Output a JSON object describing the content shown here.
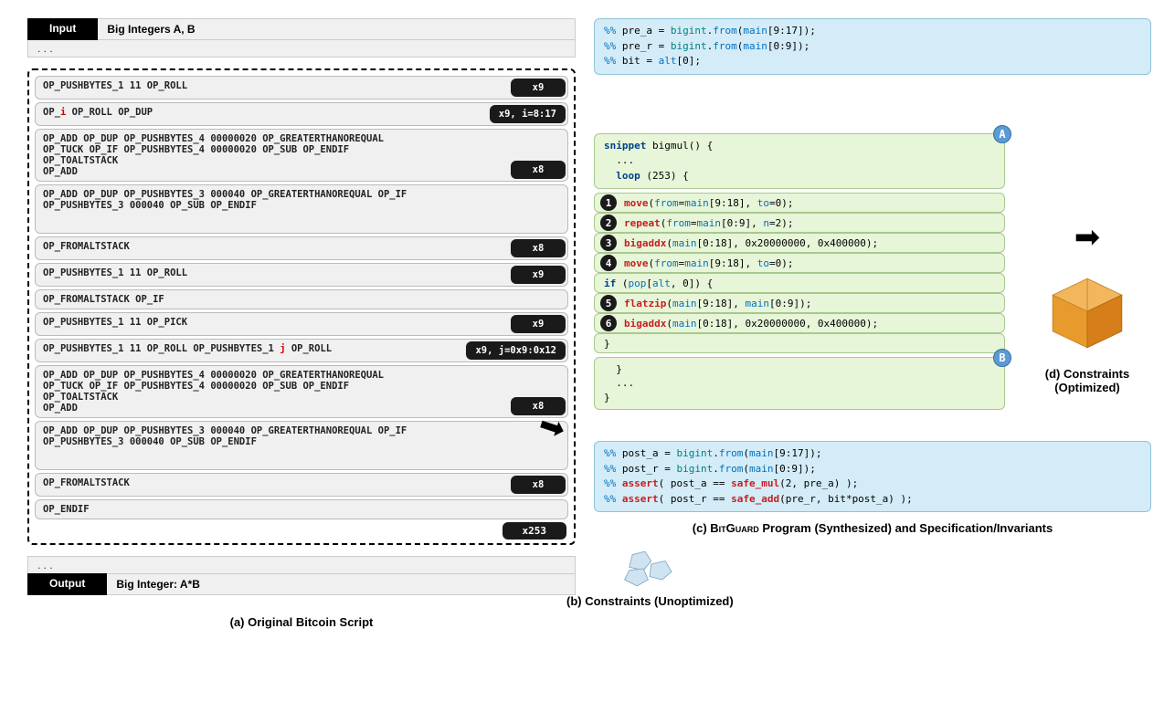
{
  "input": {
    "label": "Input",
    "value": "Big Integers A, B",
    "ellipsis": ". . ."
  },
  "output": {
    "label": "Output",
    "value": "Big Integer: A*B",
    "ellipsis": ". . ."
  },
  "captions": {
    "a": "(a) Original Bitcoin Script",
    "b": "(b) Constraints (Unoptimized)",
    "c_prefix": "(c) ",
    "c_name": "BitGuard",
    "c_suffix": " Program (Synthesized) and Specification/Invariants",
    "d": "(d) Constraints (Optimized)"
  },
  "x253": "x253",
  "ops": [
    {
      "text": "OP_PUSHBYTES_1 11 OP_ROLL",
      "badge": "x9"
    },
    {
      "pre": "OP_",
      "red": "i",
      "post": " OP_ROLL OP_DUP",
      "badge": "x9, i=8:17"
    },
    {
      "text": "OP_ADD OP_DUP OP_PUSHBYTES_4 00000020 OP_GREATERTHANOREQUAL\nOP_TUCK OP_IF OP_PUSHBYTES_4 00000020 OP_SUB OP_ENDIF\nOP_TOALTSTACK\nOP_ADD",
      "badge": "x8",
      "tall": true
    },
    {
      "text": "OP_ADD OP_DUP OP_PUSHBYTES_3 000040 OP_GREATERTHANOREQUAL OP_IF\nOP_PUSHBYTES_3 000040 OP_SUB OP_ENDIF",
      "tall": true
    },
    {
      "text": "OP_FROMALTSTACK",
      "badge": "x8"
    },
    {
      "text": "OP_PUSHBYTES_1 11 OP_ROLL",
      "badge": "x9"
    },
    {
      "text": "OP_FROMALTSTACK OP_IF"
    },
    {
      "text": "OP_PUSHBYTES_1 11 OP_PICK",
      "badge": "x9"
    },
    {
      "pre": "OP_PUSHBYTES_1 11 OP_ROLL OP_PUSHBYTES_1 ",
      "red": "j",
      "post": " OP_ROLL",
      "badge": "x9, j=0x9:0x12"
    },
    {
      "text": "OP_ADD OP_DUP OP_PUSHBYTES_4 00000020 OP_GREATERTHANOREQUAL\nOP_TUCK OP_IF OP_PUSHBYTES_4 00000020 OP_SUB OP_ENDIF\nOP_TOALTSTACK\nOP_ADD",
      "badge": "x8",
      "tall": true
    },
    {
      "text": "OP_ADD OP_DUP OP_PUSHBYTES_3 000040 OP_GREATERTHANOREQUAL OP_IF\nOP_PUSHBYTES_3 000040 OP_SUB OP_ENDIF",
      "tall": true
    },
    {
      "text": "OP_FROMALTSTACK",
      "badge": "x8"
    },
    {
      "text": "OP_ENDIF"
    }
  ],
  "spec_pre": {
    "l1": "%% pre_a = bigint.from(main[9:17]);",
    "l2": "%% pre_r = bigint.from(main[0:9]);",
    "l3": "%% bit = alt[0];"
  },
  "prog_header": {
    "l1": "snippet bigmul() {",
    "l2": "  ...",
    "l3": "  loop (253) {"
  },
  "prog_lines": [
    {
      "n": "1",
      "code": "move(from=main[9:18], to=0);"
    },
    {
      "n": "2",
      "code": "repeat(from=main[0:9], n=2);"
    },
    {
      "n": "3",
      "code": "bigaddx(main[0:18], 0x20000000, 0x400000);"
    },
    {
      "n": "4",
      "code": "move(from=main[9:18], to=0);"
    },
    {
      "code": "if (pop[alt, 0]) {",
      "nobub": true
    },
    {
      "n": "5",
      "code": "flatzip(main[9:18], main[0:9]);"
    },
    {
      "n": "6",
      "code": "bigaddx(main[0:18], 0x20000000, 0x400000);"
    },
    {
      "code": "    }",
      "nobub": true
    }
  ],
  "prog_footer": "  }\n  ...\n}",
  "spec_post": {
    "l1": "%% post_a = bigint.from(main[9:17]);",
    "l2": "%% post_r = bigint.from(main[0:9]);",
    "l3": "%% assert( post_a == safe_mul(2, pre_a) );",
    "l4": "%% assert( post_r == safe_add(pre_r, bit*post_a) );"
  },
  "letters": {
    "A": "A",
    "B": "B"
  }
}
